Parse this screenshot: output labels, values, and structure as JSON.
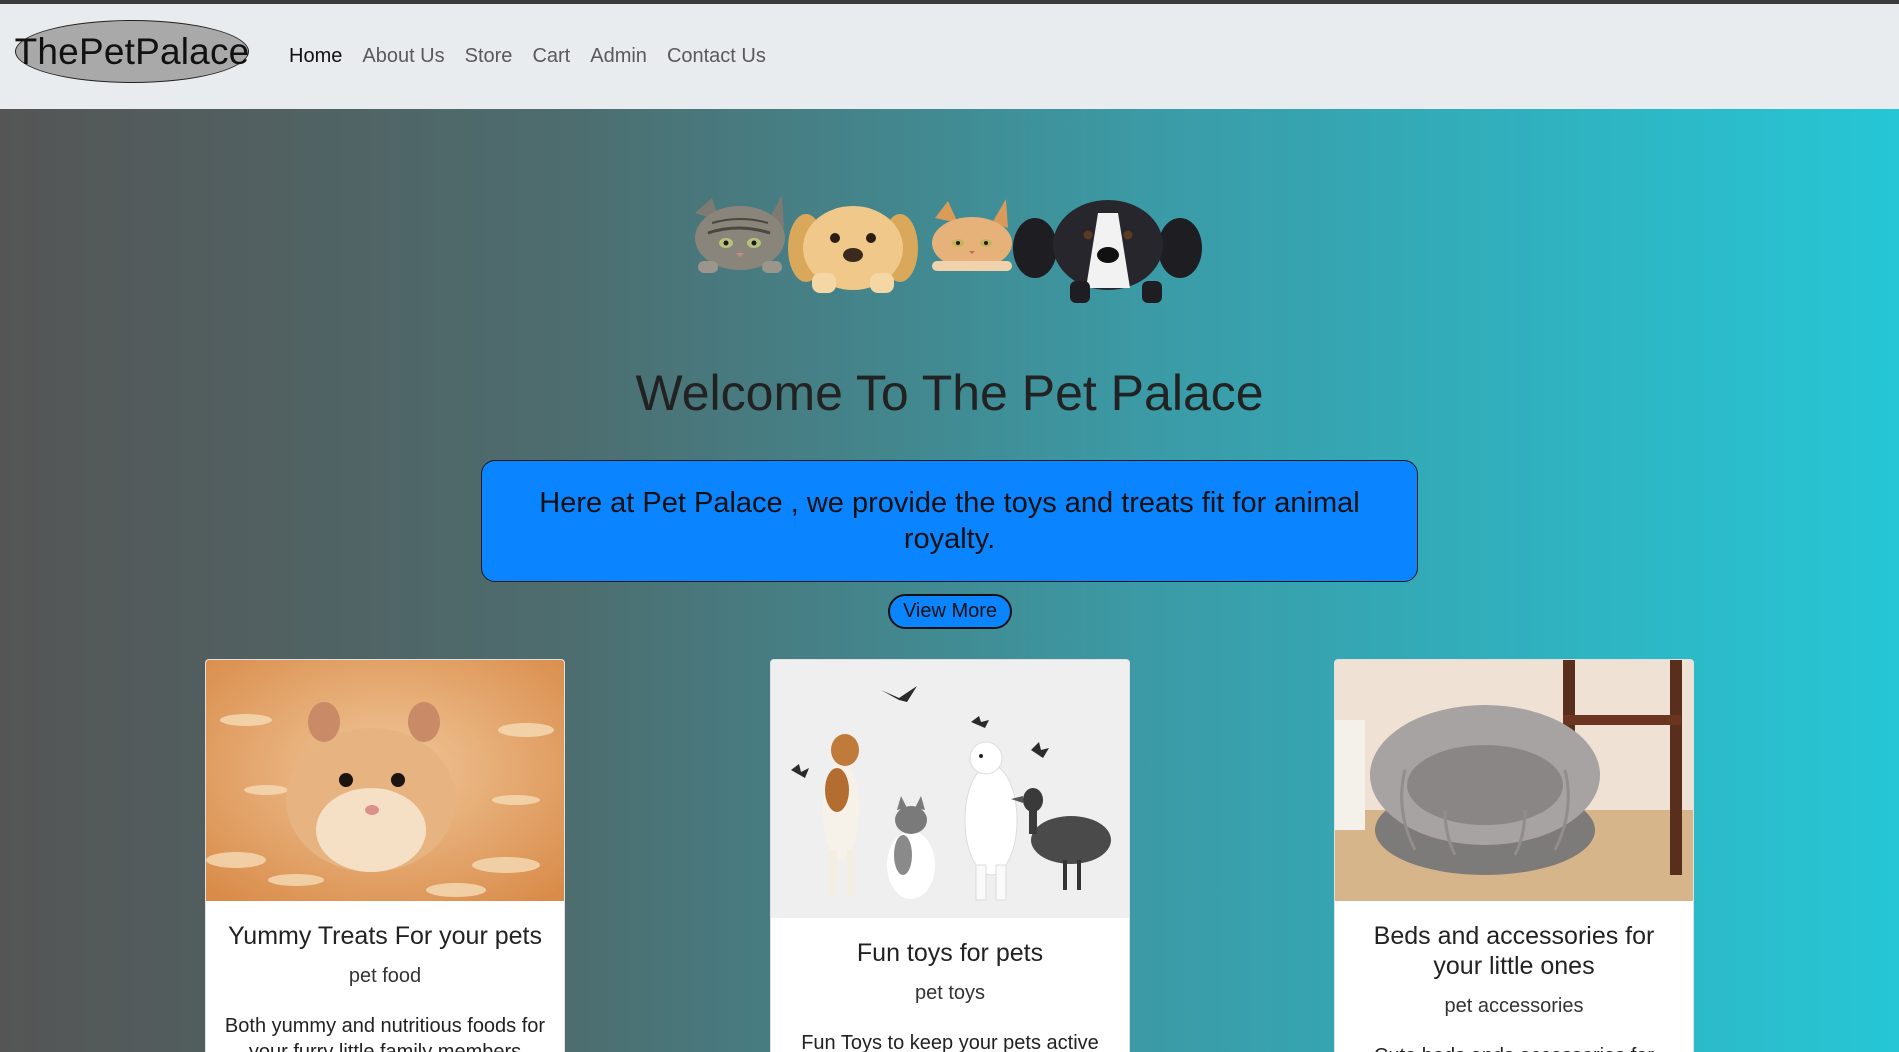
{
  "brand": "ThePetPalace",
  "nav": {
    "home": "Home",
    "about": "About Us",
    "store": "Store",
    "cart": "Cart",
    "admin": "Admin",
    "contact": "Contact Us"
  },
  "hero": {
    "title": "Welcome To The Pet Palace",
    "intro": "Here at Pet Palace , we provide the toys and treats fit for animal royalty.",
    "view_more": "View More"
  },
  "cards": [
    {
      "title": "Yummy Treats For your pets",
      "subtitle": "pet food",
      "text": "Both yummy and nutritious foods for your furry little family members"
    },
    {
      "title": "Fun toys for pets",
      "subtitle": "pet toys",
      "text": "Fun Toys to keep your pets active"
    },
    {
      "title": "Beds and accessories for your little ones",
      "subtitle": "pet accessories",
      "text": "Cute beds ands accessories for"
    }
  ],
  "colors": {
    "navbar": "#e9ecef",
    "accent": "#0a84ff",
    "gradient_start": "#555555",
    "gradient_end": "#26c6d6"
  }
}
